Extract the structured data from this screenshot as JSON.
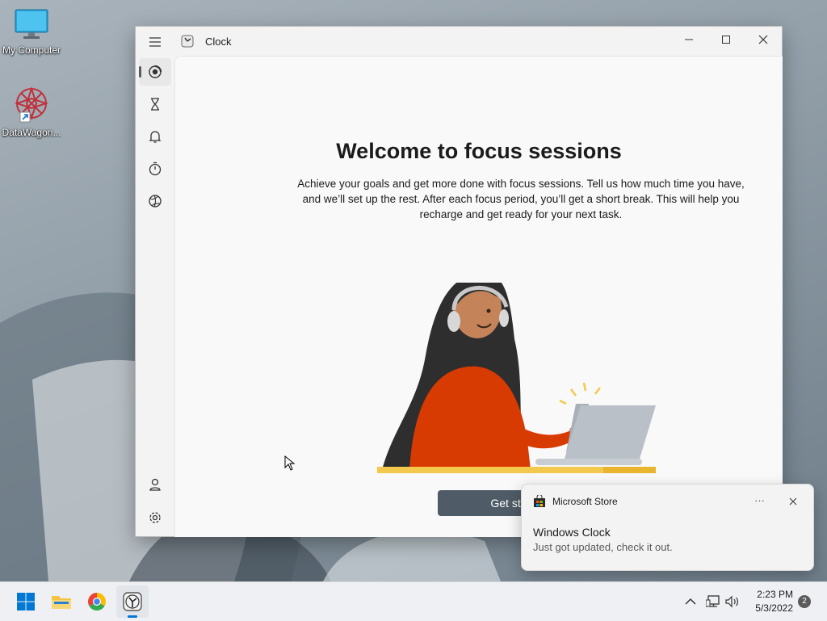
{
  "desktop": {
    "icons": [
      {
        "label": "My Computer"
      },
      {
        "label": "DataWagon..."
      }
    ]
  },
  "window": {
    "title": "Clock",
    "heading": "Welcome to focus sessions",
    "description": "Achieve your goals and get more done with focus sessions. Tell us how much time you have, and we’ll set up the rest. After each focus period, you’ll get a short break. This will help you recharge and get ready for your next task.",
    "button_label": "Get started",
    "nav": [
      "focus-sessions-icon",
      "timer-icon",
      "alarm-icon",
      "stopwatch-icon",
      "world-clock-icon"
    ]
  },
  "toast": {
    "app": "Microsoft Store",
    "more": "···",
    "title": "Windows Clock",
    "body": "Just got updated, check it out."
  },
  "taskbar": {
    "time": "2:23 PM",
    "date": "5/3/2022",
    "notification_count": "2"
  },
  "colors": {
    "accent_button": "#4f5b66",
    "shirt": "#d83b01",
    "desk": "#f2c94c"
  }
}
